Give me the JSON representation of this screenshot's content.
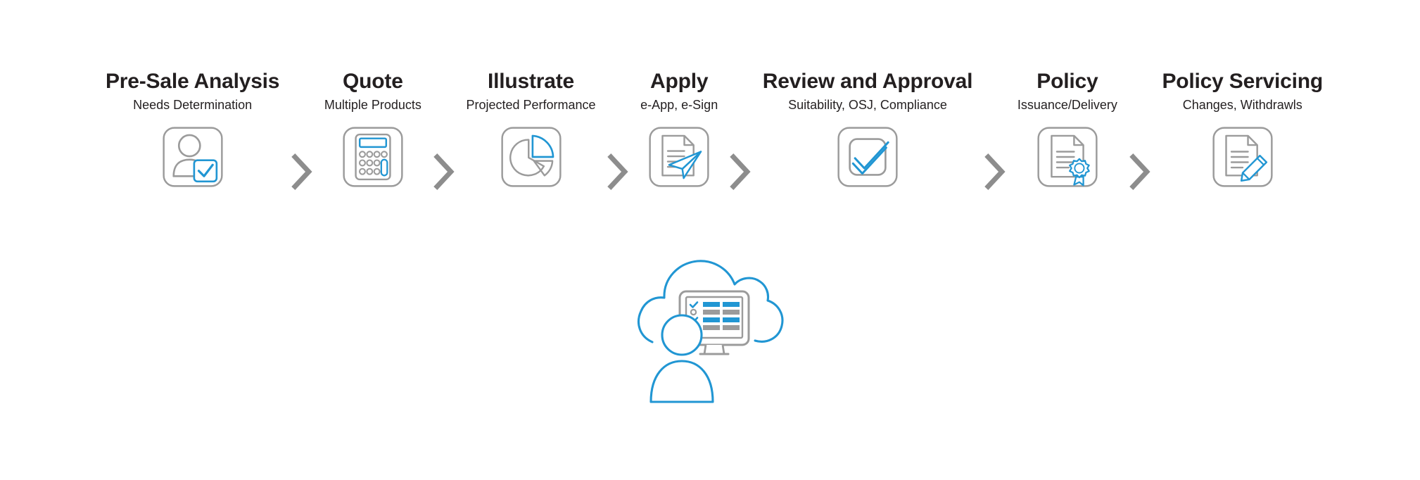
{
  "colors": {
    "accent_blue": "#2196d3",
    "outline_gray": "#9b9b9b",
    "text_dark": "#231f20",
    "background": "#ffffff",
    "screen_bar_blue": "#2196d3",
    "screen_bar_gray": "#9b9b9b"
  },
  "flow": {
    "stages": [
      {
        "title": "Pre-Sale Analysis",
        "subtitle": "Needs Determination",
        "icon": "person-check-icon"
      },
      {
        "title": "Quote",
        "subtitle": "Multiple Products",
        "icon": "calculator-icon"
      },
      {
        "title": "Illustrate",
        "subtitle": "Projected Performance",
        "icon": "pie-chart-icon"
      },
      {
        "title": "Apply",
        "subtitle": "e-App, e-Sign",
        "icon": "document-paper-airplane-icon"
      },
      {
        "title": "Review and Approval",
        "subtitle": "Suitability, OSJ, Compliance",
        "icon": "checkbox-approved-icon"
      },
      {
        "title": "Policy",
        "subtitle": "Issuance/Delivery",
        "icon": "document-seal-icon"
      },
      {
        "title": "Policy Servicing",
        "subtitle": "Changes, Withdrawls",
        "icon": "document-pencil-icon"
      }
    ],
    "separator_icon": "chevron-right-icon",
    "separator_count": 6
  },
  "illustration": {
    "name": "cloud-user-monitor-illustration",
    "elements": [
      "cloud-outline",
      "desktop-monitor",
      "user-avatar-silhouette",
      "checklist-rows"
    ],
    "checklist_rows": [
      {
        "marker": "check",
        "marker_color": "#2196d3",
        "bar_color": "#2196d3"
      },
      {
        "marker": "circle",
        "marker_color": "#9b9b9b",
        "bar_color": "#9b9b9b"
      },
      {
        "marker": "check",
        "marker_color": "#2196d3",
        "bar_color": "#2196d3"
      },
      {
        "marker": "none",
        "marker_color": "#9b9b9b",
        "bar_color": "#9b9b9b"
      }
    ]
  }
}
